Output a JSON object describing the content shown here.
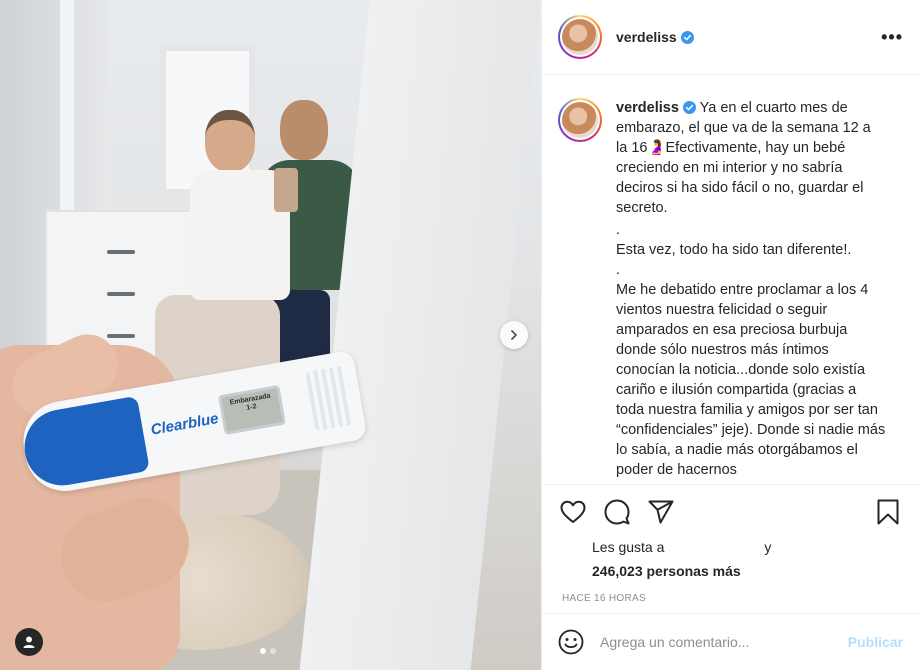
{
  "post": {
    "username": "verdeliss",
    "more_label": "•••"
  },
  "photo": {
    "test_brand": "Clearblue",
    "test_screen_line1": "Embarazada",
    "test_screen_line2": "1-2",
    "slide_count": 2,
    "active_slide": 1
  },
  "caption": {
    "username": "verdeliss",
    "paragraphs": [
      "Ya en el cuarto mes de embarazo, el que va de la semana 12 a la 16🤰Efectivamente, hay un bebé creciendo en mi interior y no sabría deciros si ha sido fácil o no, guardar el secreto.",
      ".",
      "Esta vez, todo ha sido tan diferente!.",
      ".",
      "Me he debatido entre proclamar a los 4 vientos nuestra felicidad o seguir amparados en esa preciosa burbuja donde sólo nuestros más íntimos conocían la noticia...donde solo existía cariño e ilusión compartida (gracias a toda nuestra familia y amigos por ser tan “confidenciales” jeje). Donde si nadie más lo sabía, a nadie más otorgábamos el poder de hacernos"
    ]
  },
  "actions": {
    "icons": [
      "heart-icon",
      "comment-icon",
      "share-icon",
      "bookmark-icon"
    ]
  },
  "likes": {
    "prefix": "Les gusta a",
    "suffix": "y",
    "count_text": "246,023 personas más"
  },
  "time": "HACE 16 HORAS",
  "comment": {
    "placeholder": "Agrega un comentario...",
    "post_label": "Publicar"
  },
  "colors": {
    "verified": "#3897f0",
    "post_disabled": "#b2dffc",
    "muted": "#8e8e8e"
  }
}
